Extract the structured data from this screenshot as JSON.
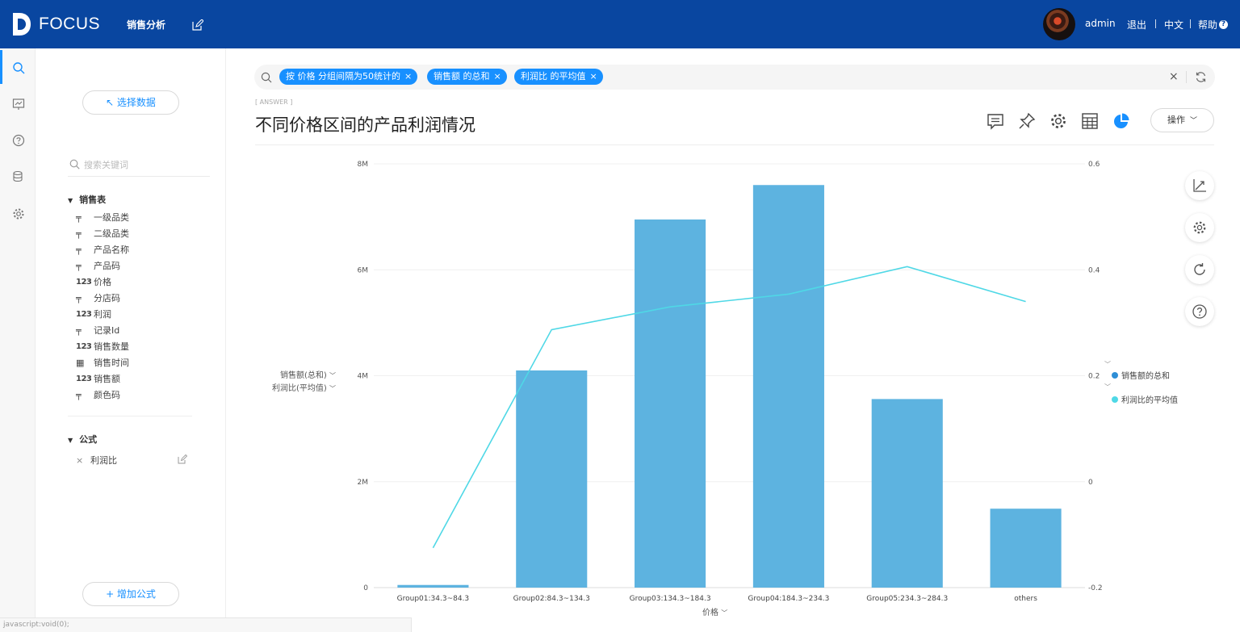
{
  "app": {
    "logo_text": "FOCUS",
    "nav_title": "销售分析",
    "user_name": "admin",
    "links": {
      "logout": "退出",
      "lang": "中文",
      "help": "帮助"
    }
  },
  "sidebar": {
    "select_data_label": "↖ 选择数据",
    "search_placeholder": "搜索关键词",
    "table_name": "销售表",
    "fields": [
      {
        "type": "text",
        "type_label": "╤",
        "name": "一级品类"
      },
      {
        "type": "text",
        "type_label": "╤",
        "name": "二级品类"
      },
      {
        "type": "text",
        "type_label": "╤",
        "name": "产品名称"
      },
      {
        "type": "text",
        "type_label": "╤",
        "name": "产品码"
      },
      {
        "type": "number",
        "type_label": "123",
        "name": "价格"
      },
      {
        "type": "text",
        "type_label": "╤",
        "name": "分店码"
      },
      {
        "type": "number",
        "type_label": "123",
        "name": "利润"
      },
      {
        "type": "text",
        "type_label": "╤",
        "name": "记录Id"
      },
      {
        "type": "number",
        "type_label": "123",
        "name": "销售数量"
      },
      {
        "type": "date",
        "type_label": "▦",
        "name": "销售时间"
      },
      {
        "type": "number",
        "type_label": "123",
        "name": "销售额"
      },
      {
        "type": "text",
        "type_label": "╤",
        "name": "颜色码"
      }
    ],
    "formula_section": "公式",
    "formulas": [
      {
        "name": "利润比"
      }
    ],
    "add_formula_label": "+ 增加公式"
  },
  "query": {
    "chips": [
      {
        "label": "按  价格  分组间隔为50统计的"
      },
      {
        "label": "销售额  的总和"
      },
      {
        "label": "利润比  的平均值"
      }
    ]
  },
  "answer": {
    "tag": "[ ANSWER ]",
    "title": "不同价格区间的产品利润情况",
    "ops_label": "操作"
  },
  "status_text": "javascript:void(0);",
  "chart_data": {
    "type": "bar",
    "categories": [
      "Group01:34.3~84.3",
      "Group02:84.3~134.3",
      "Group03:134.3~184.3",
      "Group04:184.3~234.3",
      "Group05:234.3~284.3",
      "others"
    ],
    "series": [
      {
        "name": "销售额的总和",
        "type": "bar",
        "axis": "left",
        "color": "#5db3e0",
        "values": [
          50000,
          4100000,
          6950000,
          7600000,
          3560000,
          1490000
        ]
      },
      {
        "name": "利润比的平均值",
        "type": "line",
        "axis": "right",
        "color": "#4fd8e6",
        "values": [
          -0.125,
          0.287,
          0.33,
          0.354,
          0.406,
          0.34
        ]
      }
    ],
    "ylabel_left_items": [
      "销售额(总和)",
      "利润比(平均值)"
    ],
    "xlabel": "价格",
    "left_ticks": [
      "0",
      "2M",
      "4M",
      "6M",
      "8M"
    ],
    "right_ticks": [
      "-0.2",
      "0",
      "0.2",
      "0.4",
      "0.6"
    ],
    "ylim_left": [
      0,
      8000000
    ],
    "ylim_right": [
      -0.2,
      0.6
    ],
    "legend_position": "right",
    "grid": true
  }
}
